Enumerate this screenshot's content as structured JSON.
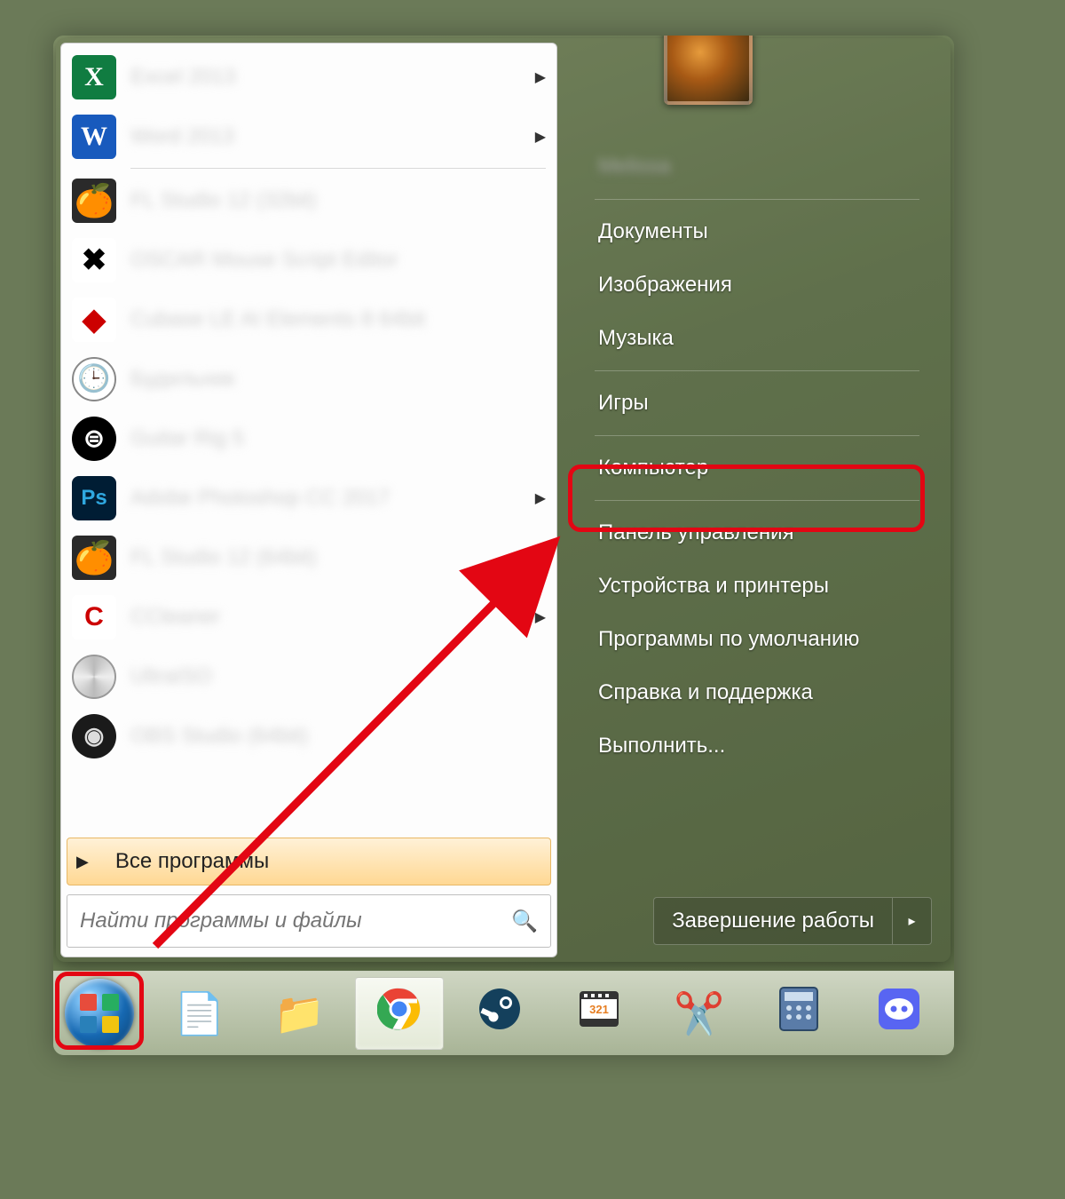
{
  "left_pane": {
    "programs": [
      {
        "icon": "excel",
        "label": "Excel 2013",
        "has_submenu": true
      },
      {
        "icon": "word",
        "label": "Word 2013",
        "has_submenu": true
      },
      {
        "icon": "flstudio",
        "label": "FL Studio 12 (32bit)",
        "has_submenu": false
      },
      {
        "icon": "oscar",
        "label": "OSCAR Mouse Script Editor",
        "has_submenu": false
      },
      {
        "icon": "cubase",
        "label": "Cubase LE AI Elements 8 64bit",
        "has_submenu": false
      },
      {
        "icon": "alarm",
        "label": "Будильник",
        "has_submenu": false
      },
      {
        "icon": "guitarrig",
        "label": "Guitar Rig 5",
        "has_submenu": false
      },
      {
        "icon": "photoshop",
        "label": "Adobe Photoshop CC 2017",
        "has_submenu": true
      },
      {
        "icon": "flstudio",
        "label": "FL Studio 12 (64bit)",
        "has_submenu": false
      },
      {
        "icon": "ccleaner",
        "label": "CCleaner",
        "has_submenu": true
      },
      {
        "icon": "ultraiso",
        "label": "UltraISO",
        "has_submenu": false
      },
      {
        "icon": "obs",
        "label": "OBS Studio (64bit)",
        "has_submenu": false
      }
    ],
    "all_programs": "Все программы",
    "search_placeholder": "Найти программы и файлы"
  },
  "right_pane": {
    "user_name": "Melissa",
    "items": [
      {
        "key": "documents",
        "label": "Документы"
      },
      {
        "key": "pictures",
        "label": "Изображения"
      },
      {
        "key": "music",
        "label": "Музыка"
      },
      {
        "key": "games",
        "label": "Игры"
      },
      {
        "key": "computer",
        "label": "Компьютер"
      },
      {
        "key": "control_panel",
        "label": "Панель управления"
      },
      {
        "key": "devices",
        "label": "Устройства и принтеры"
      },
      {
        "key": "defaults",
        "label": "Программы по умолчанию"
      },
      {
        "key": "help",
        "label": "Справка и поддержка"
      },
      {
        "key": "run",
        "label": "Выполнить..."
      }
    ],
    "shutdown": "Завершение работы"
  },
  "taskbar": {
    "items": [
      {
        "key": "start",
        "name": "start-orb"
      },
      {
        "key": "notepad",
        "name": "notepad-icon"
      },
      {
        "key": "explorer",
        "name": "explorer-icon"
      },
      {
        "key": "chrome",
        "name": "chrome-icon",
        "active": true
      },
      {
        "key": "steam",
        "name": "steam-icon"
      },
      {
        "key": "mpc",
        "name": "mpc-icon"
      },
      {
        "key": "snip",
        "name": "snipping-tool-icon"
      },
      {
        "key": "calc",
        "name": "calculator-icon"
      },
      {
        "key": "discord",
        "name": "discord-icon"
      }
    ]
  },
  "highlighted": "control_panel"
}
